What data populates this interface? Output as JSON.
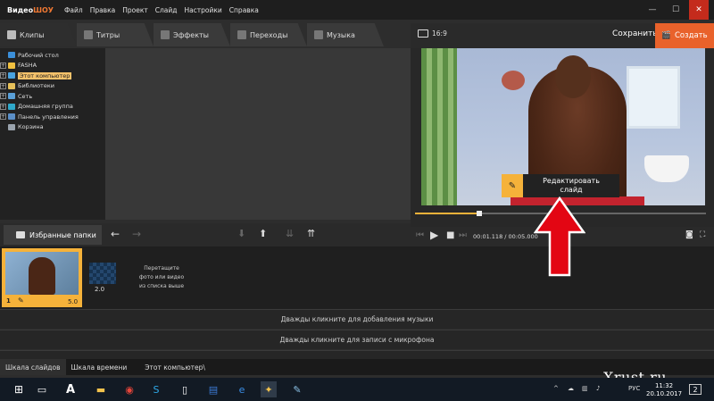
{
  "app": {
    "logo_main": "Видео",
    "logo_accent": "ШОУ",
    "menu": [
      "Файл",
      "Правка",
      "Проект",
      "Слайд",
      "Настройки",
      "Справка"
    ],
    "window_controls": [
      "—",
      "☐",
      "✕"
    ]
  },
  "tabs": [
    {
      "label": "Клипы",
      "active": true
    },
    {
      "label": "Титры",
      "active": false
    },
    {
      "label": "Эффекты",
      "active": false
    },
    {
      "label": "Переходы",
      "active": false
    },
    {
      "label": "Музыка",
      "active": false
    }
  ],
  "right_header": {
    "ratio": "16:9",
    "save": "Сохранить",
    "create": "Создать"
  },
  "tree": [
    {
      "label": "Рабочий стол",
      "expander": "",
      "color": "#3b8fd9",
      "selected": false
    },
    {
      "label": "FASHA",
      "expander": "+",
      "color": "#f0c040",
      "selected": false
    },
    {
      "label": "Этот компьютер",
      "expander": "+",
      "color": "#4aa3df",
      "selected": true
    },
    {
      "label": "Библиотеки",
      "expander": "+",
      "color": "#e6c05a",
      "selected": false
    },
    {
      "label": "Сеть",
      "expander": "+",
      "color": "#5aa0d8",
      "selected": false
    },
    {
      "label": "Домашняя группа",
      "expander": "+",
      "color": "#2fa8c9",
      "selected": false
    },
    {
      "label": "Панель управления",
      "expander": "+",
      "color": "#5b8fc7",
      "selected": false
    },
    {
      "label": "Корзина",
      "expander": "",
      "color": "#9aa3ad",
      "selected": false
    }
  ],
  "favorites": {
    "label": "Избранные папки",
    "back": "←",
    "forward": "→"
  },
  "preview": {
    "edit_tip_line1": "Редактировать",
    "edit_tip_line2": "слайд",
    "progress": 0.22
  },
  "playback": {
    "timecode": "00:01.118 / 00:05.000"
  },
  "timeline": {
    "clip": {
      "number": "1",
      "duration": "5.0"
    },
    "transition_duration": "2.0",
    "drop_hint_1": "Перетащите",
    "drop_hint_2": "фото или видео",
    "drop_hint_3": "из списка выше",
    "music_track": "Дважды кликните для добавления музыки",
    "mic_track": "Дважды кликните для записи с микрофона"
  },
  "status": {
    "tabs": [
      "Шкала слайдов",
      "Шкала времени"
    ],
    "path": "Этот компьютер\\"
  },
  "watermark": "Xrust.ru",
  "taskbar": {
    "lang": "РУС",
    "time": "11:32",
    "date": "20.10.2017",
    "notifications": "2"
  },
  "colors": {
    "accent": "#e9622b",
    "highlight": "#f5b23a"
  }
}
